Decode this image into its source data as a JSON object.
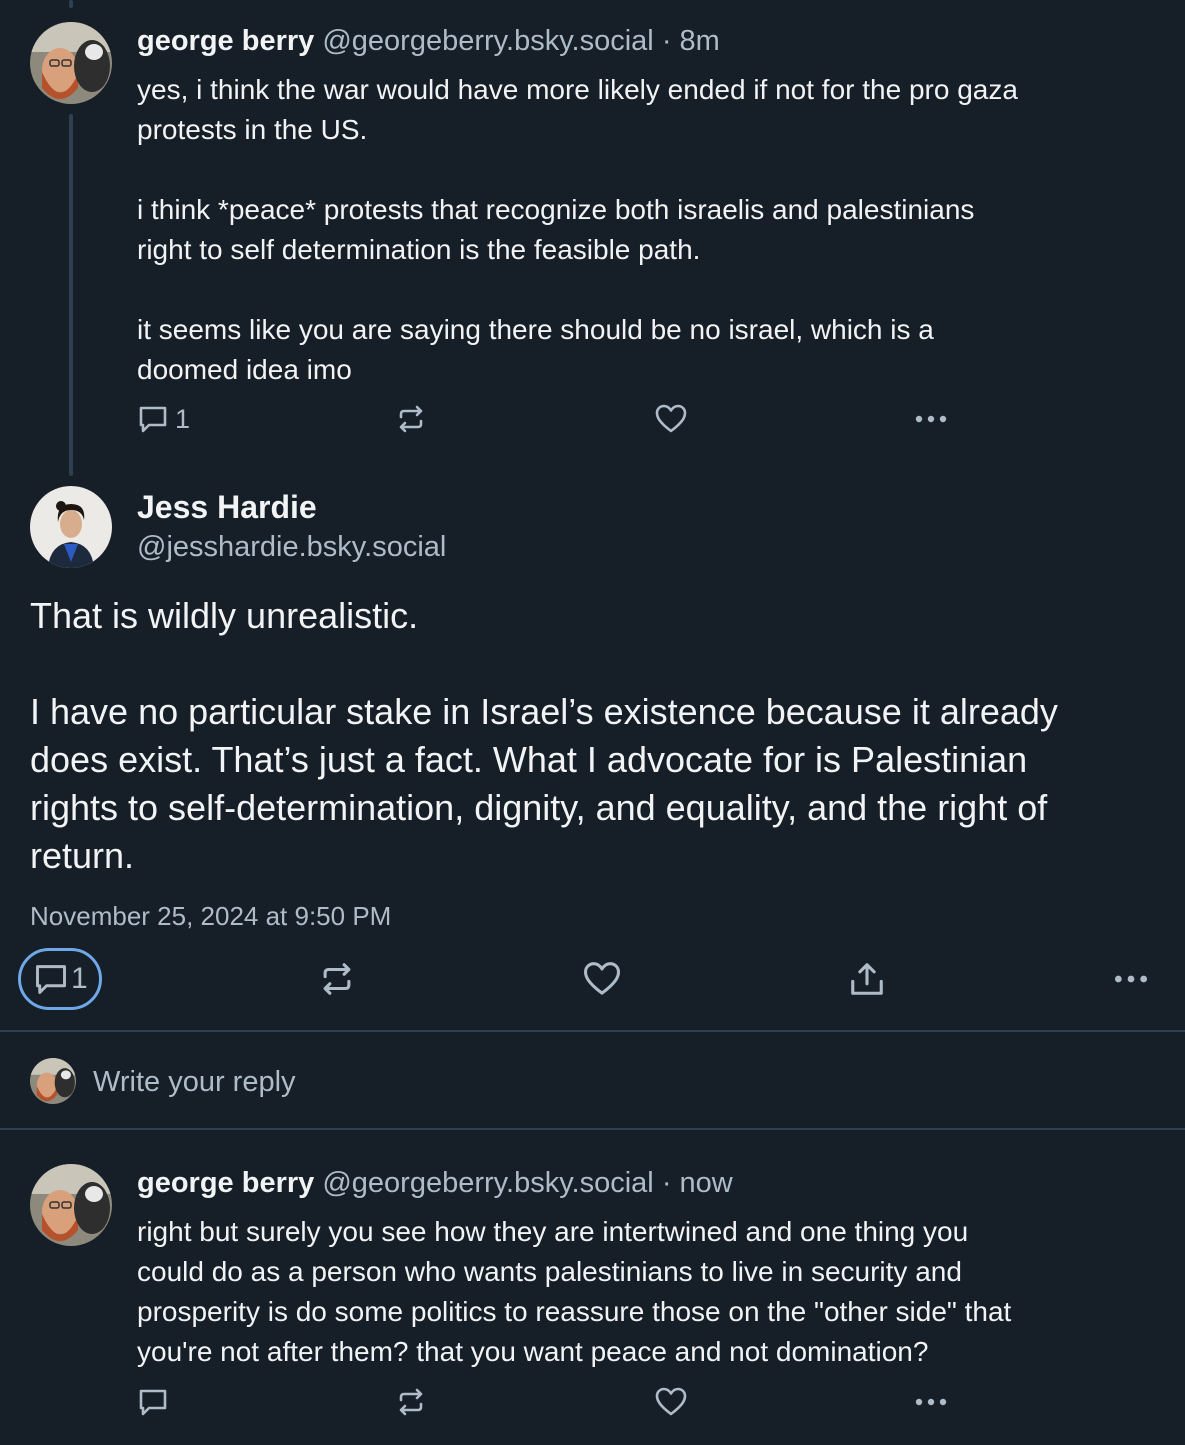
{
  "posts": [
    {
      "author": "george berry",
      "handle": "@georgeberry.bsky.social",
      "sep": "·",
      "time": "8m",
      "body": "yes, i think the war would have more likely ended if not for the pro gaza\nprotests in the US.\n\ni think *peace* protests that recognize both israelis and palestinians\nright to self determination is the feasible path.\n\nit seems like you are saying there should be no israel, which is a\ndoomed idea imo",
      "reply_count": "1",
      "icons": [
        "reply-icon",
        "repost-icon",
        "like-icon",
        "more-icon"
      ]
    },
    {
      "author": "george berry",
      "handle": "@georgeberry.bsky.social",
      "sep": "·",
      "time": "now",
      "body": "right but surely you see how they are intertwined and one thing you\ncould do as a person who wants palestinians to live in security and\nprosperity is do some politics to reassure those on the \"other side\" that\nyou're not after them? that you want peace and not domination?",
      "reply_count": "",
      "icons": [
        "reply-icon",
        "repost-icon",
        "like-icon",
        "more-icon"
      ]
    }
  ],
  "main_post": {
    "author": "Jess Hardie",
    "handle": "@jesshardie.bsky.social",
    "body": "That is wildly unrealistic.\n\nI have no particular stake in Israel’s existence because it already\ndoes exist. That’s just a fact. What I advocate for is Palestinian\nrights to self-determination, dignity, and equality, and the right of\nreturn.",
    "timestamp": "November 25, 2024 at 9:50 PM",
    "reply_count": "1",
    "icons": [
      "reply-icon",
      "repost-icon",
      "like-icon",
      "share-icon",
      "more-icon"
    ]
  },
  "composer": {
    "placeholder": "Write your reply"
  },
  "colors": {
    "background": "#161e27",
    "text": "#f1f3f5",
    "muted": "#aebbc9",
    "divider": "#2e4052",
    "focus_ring": "#6ea8e8"
  }
}
